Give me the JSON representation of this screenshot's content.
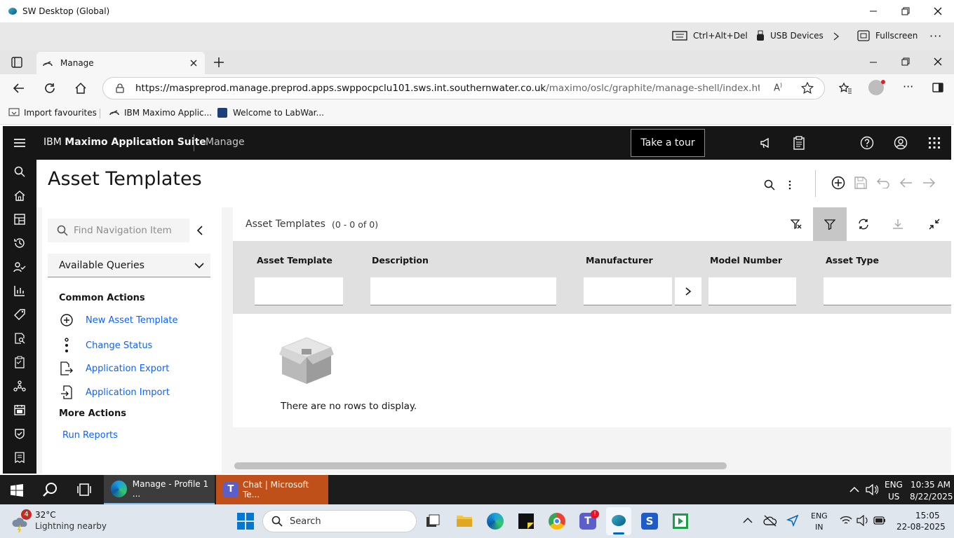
{
  "remote_window": {
    "title": "SW Desktop (Global)",
    "toolbar": {
      "ctrl_alt_del": "Ctrl+Alt+Del",
      "usb_devices": "USB Devices",
      "fullscreen": "Fullscreen"
    }
  },
  "browser": {
    "tab_title": "Manage",
    "url_host": "https://maspreprod.manage.preprod.apps.swppocpclu101.sws.int.southernwater.co.uk",
    "url_path": "/maximo/oslc/graphite/manage-shell/index.html?event=...",
    "favourites": [
      "Import favourites",
      "IBM Maximo Applic...",
      "Welcome to LabWar..."
    ]
  },
  "app": {
    "brand_prefix": "IBM ",
    "brand_bold": "Maximo Application Suite",
    "module": "Manage",
    "tour_button": "Take a tour",
    "page_title": "Asset Templates"
  },
  "nav": {
    "search_placeholder": "Find Navigation Item",
    "queries_label": "Available Queries",
    "common_actions_heading": "Common Actions",
    "common_actions": [
      "New Asset Template",
      "Change Status",
      "Application Export",
      "Application Import"
    ],
    "more_actions_heading": "More Actions",
    "more_actions": [
      "Run Reports"
    ]
  },
  "table": {
    "title": "Asset Templates",
    "count": "(0 - 0 of 0)",
    "columns": [
      "Asset Template",
      "Description",
      "Manufacturer",
      "Model Number",
      "Asset Type"
    ],
    "empty_message": "There are no rows to display."
  },
  "taskbar": {
    "apps": [
      "Manage - Profile 1 ...",
      "Chat | Microsoft Te..."
    ],
    "lang_top": "ENG",
    "lang_bottom": "US",
    "time": "10:35 AM",
    "date": "8/22/2025"
  },
  "host_taskbar": {
    "weather_badge": "4",
    "temperature": "32°C",
    "weather_text": "Lightning nearby",
    "search_label": "Search",
    "lang_top": "ENG",
    "lang_bottom": "IN",
    "time": "15:05",
    "date": "22-08-2025"
  }
}
